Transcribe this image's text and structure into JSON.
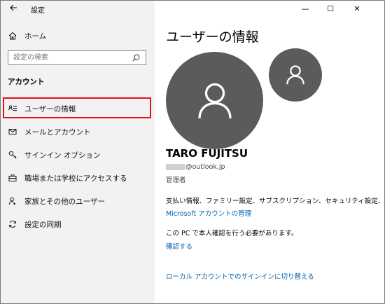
{
  "window": {
    "title": "設定",
    "back_icon": "back-arrow-icon",
    "minimize_glyph": "—",
    "maximize_glyph": "☐",
    "close_glyph": "✕"
  },
  "sidebar": {
    "home_label": "ホーム",
    "search_placeholder": "設定の検索",
    "section_title": "アカウント",
    "items": [
      {
        "label": "ユーザーの情報",
        "icon": "user-info-icon",
        "selected": true
      },
      {
        "label": "メールとアカウント",
        "icon": "mail-icon",
        "selected": false
      },
      {
        "label": "サインイン オプション",
        "icon": "key-icon",
        "selected": false
      },
      {
        "label": "職場または学校にアクセスする",
        "icon": "briefcase-icon",
        "selected": false
      },
      {
        "label": "家族とその他のユーザー",
        "icon": "person-add-icon",
        "selected": false
      },
      {
        "label": "設定の同期",
        "icon": "sync-icon",
        "selected": false
      }
    ]
  },
  "main": {
    "title": "ユーザーの情報",
    "user_name": "TARO FUJITSU",
    "email_domain": "@outlook.jp",
    "account_type": "管理者",
    "billing_text": "支払い情報、ファミリー設定、サブスクリプション、セキュリティ設定、その他",
    "manage_link": "Microsoft アカウントの管理",
    "verify_text": "この PC で本人確認を行う必要があります。",
    "verify_link": "確認する",
    "local_link": "ローカル アカウントでのサインインに切り替える"
  },
  "colors": {
    "sidebar_bg": "#f2f2f2",
    "link": "#0063b1",
    "avatar": "#5b5b5b",
    "highlight": "#e81123"
  }
}
